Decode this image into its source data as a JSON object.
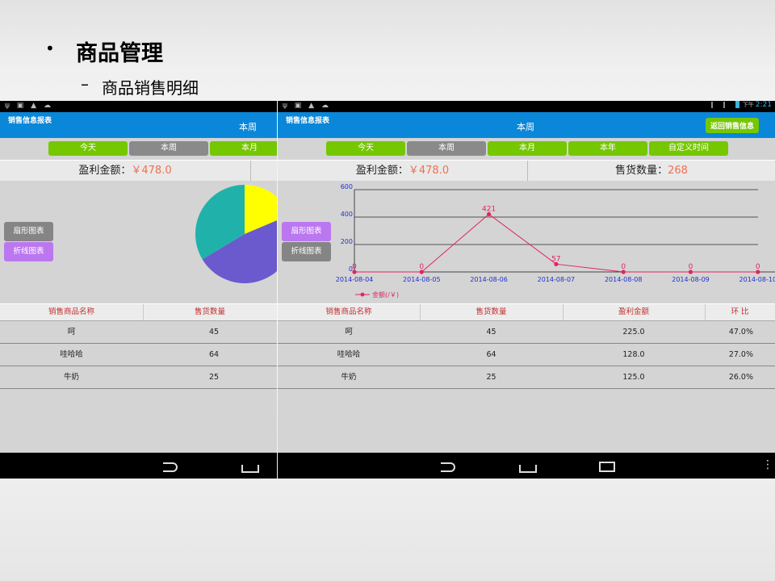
{
  "slide": {
    "bullet": "•",
    "title": "商品管理",
    "sub_dash": "–",
    "subtitle": "商品销售明细"
  },
  "status_bar": {
    "time": "2:21",
    "ampm": "下午",
    "left_icons": "ψ ▣ ▲ ☁"
  },
  "app": {
    "label": "销售信息报表",
    "current_period": "本周",
    "return_button": "返回销售信息"
  },
  "screen1": {
    "tabs": [
      {
        "label": "今天",
        "selected": false
      },
      {
        "label": "本周",
        "selected": true
      },
      {
        "label": "本月",
        "selected": false
      }
    ],
    "summary": {
      "profit_label": "盈利金额：",
      "profit_value": "￥478.0"
    },
    "side_buttons": [
      {
        "label": "扇形图表",
        "active": true
      },
      {
        "label": "折线图表",
        "active": false
      }
    ],
    "table": {
      "headers": [
        "销售商品名称",
        "售货数量"
      ],
      "rows": [
        [
          "呵",
          "45"
        ],
        [
          "哇哈哈",
          "64"
        ],
        [
          "牛奶",
          "25"
        ]
      ]
    }
  },
  "screen2": {
    "tabs": [
      {
        "label": "今天",
        "selected": false
      },
      {
        "label": "本周",
        "selected": true
      },
      {
        "label": "本月",
        "selected": false
      },
      {
        "label": "本年",
        "selected": false
      },
      {
        "label": "自定义时间",
        "selected": false
      }
    ],
    "summary": {
      "profit_label": "盈利金额：",
      "profit_value": "￥478.0",
      "qty_label": "售货数量：",
      "qty_value": "268"
    },
    "side_buttons": [
      {
        "label": "扇形图表",
        "active": false
      },
      {
        "label": "折线图表",
        "active": true
      }
    ],
    "table": {
      "headers": [
        "销售商品名称",
        "售货数量",
        "盈利金额",
        "环 比"
      ],
      "rows": [
        [
          "呵",
          "45",
          "225.0",
          "47.0%"
        ],
        [
          "哇哈哈",
          "64",
          "128.0",
          "27.0%"
        ],
        [
          "牛奶",
          "25",
          "125.0",
          "26.0%"
        ]
      ]
    }
  },
  "colors": {
    "appbar": "#0a87d8",
    "tab_green": "#75c700",
    "tab_gray": "#8a8a8a",
    "value_orange": "#f07050",
    "header_red": "#c23030",
    "line": "#e0245e",
    "axis_blue": "#2030d0"
  },
  "chart_data": [
    {
      "type": "pie",
      "categories": [
        "呵",
        "哇哈哈",
        "牛奶"
      ],
      "values": [
        45,
        64,
        25
      ],
      "colors": [
        "#20b2aa",
        "#6a5acd",
        "#ffff00"
      ]
    },
    {
      "type": "line",
      "x": [
        "2014-08-04",
        "2014-08-05",
        "2014-08-06",
        "2014-08-07",
        "2014-08-08",
        "2014-08-09",
        "2014-08-10"
      ],
      "series": [
        {
          "name": "金额(/￥)",
          "values": [
            0,
            0,
            421,
            57,
            0,
            0,
            0
          ]
        }
      ],
      "data_labels": [
        "0",
        "0",
        "421",
        "57",
        "0",
        "0",
        "0"
      ],
      "y_ticks": [
        "600",
        "400",
        "200",
        "0"
      ],
      "x_tick_labels": [
        "2014-08-04",
        "2014-08-05",
        "2014-08-06",
        "2014-08-07",
        "2014-08-08",
        "2014-08-09",
        "2014-08-10"
      ],
      "ylim": [
        0,
        600
      ],
      "grid": true,
      "legend": "bottom-left"
    }
  ]
}
